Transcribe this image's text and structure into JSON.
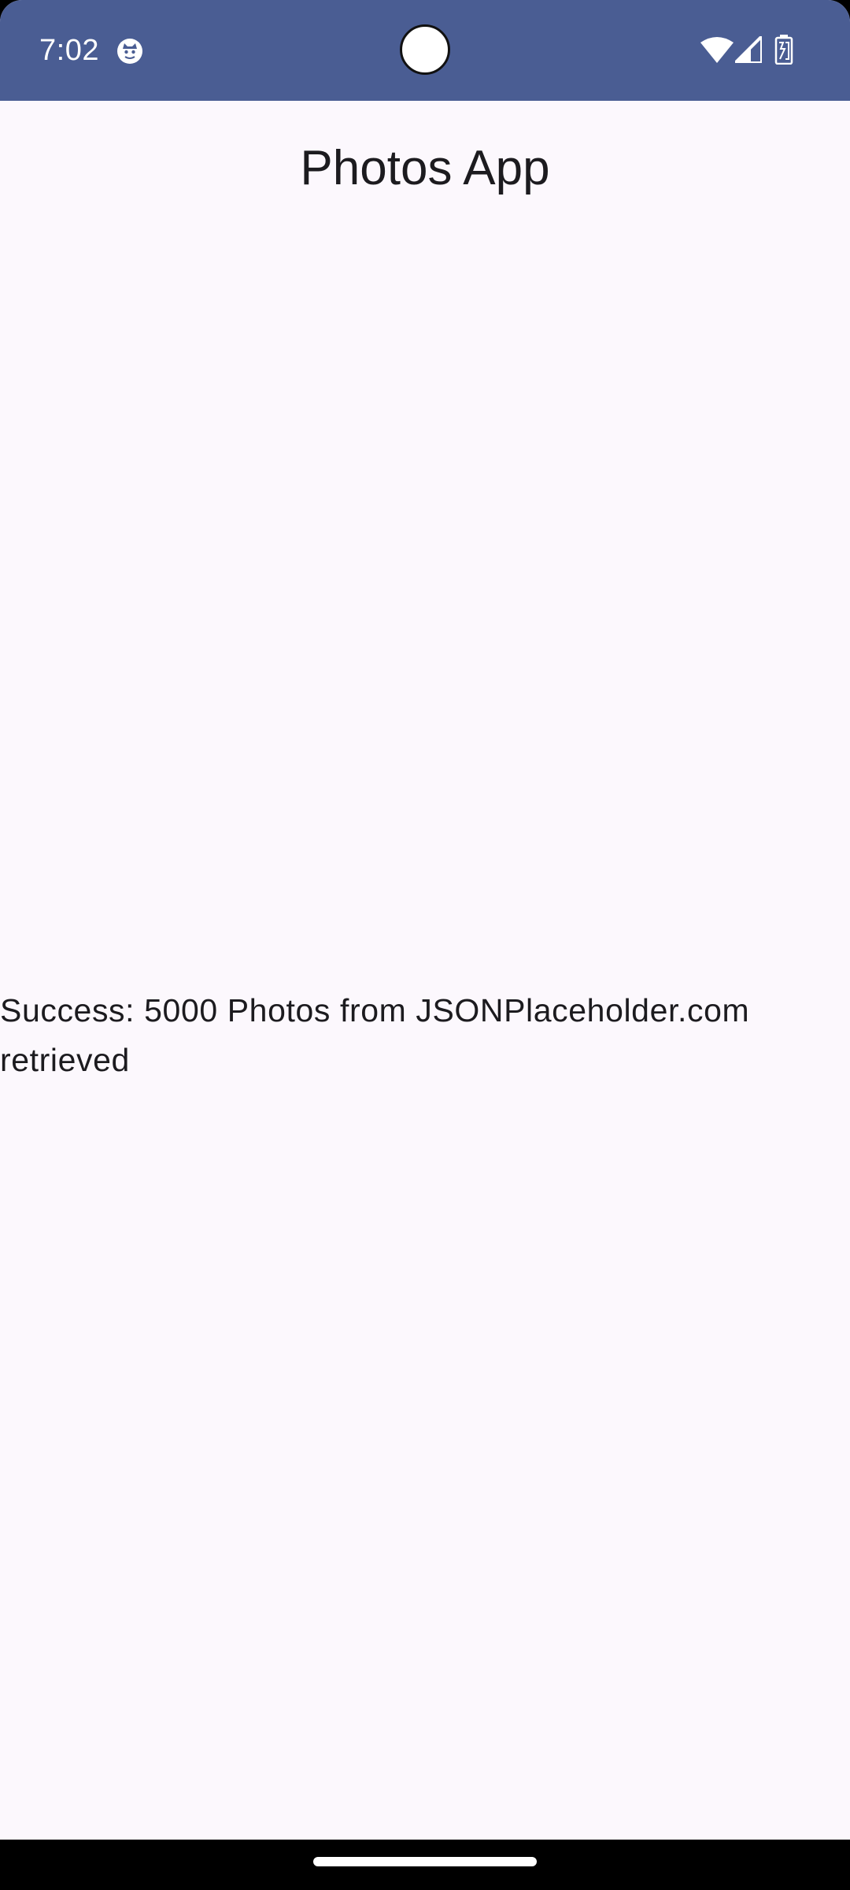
{
  "status_bar": {
    "time": "7:02",
    "background_color": "#4a5d93",
    "icons": [
      "app-notification-icon",
      "wifi-icon",
      "signal-icon",
      "battery-icon"
    ]
  },
  "app": {
    "title": "Photos App",
    "message": "Success: 5000 Photos from JSONPlaceholder.com retrieved",
    "background_color": "#fcf8fd"
  }
}
